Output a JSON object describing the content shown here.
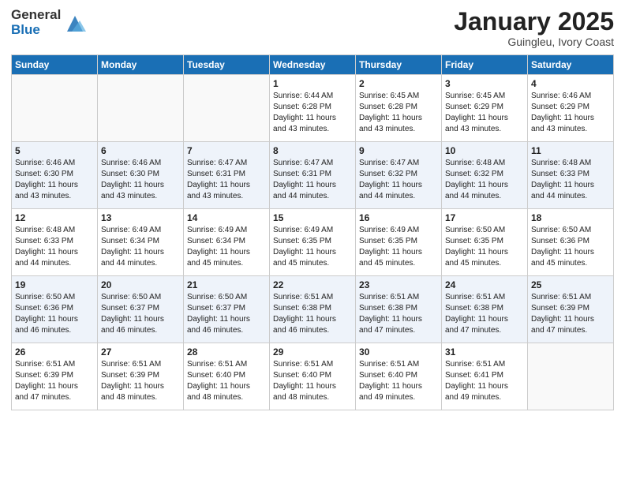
{
  "header": {
    "logo_general": "General",
    "logo_blue": "Blue",
    "month_title": "January 2025",
    "location": "Guingleu, Ivory Coast"
  },
  "weekdays": [
    "Sunday",
    "Monday",
    "Tuesday",
    "Wednesday",
    "Thursday",
    "Friday",
    "Saturday"
  ],
  "weeks": [
    [
      {
        "day": "",
        "info": ""
      },
      {
        "day": "",
        "info": ""
      },
      {
        "day": "",
        "info": ""
      },
      {
        "day": "1",
        "info": "Sunrise: 6:44 AM\nSunset: 6:28 PM\nDaylight: 11 hours\nand 43 minutes."
      },
      {
        "day": "2",
        "info": "Sunrise: 6:45 AM\nSunset: 6:28 PM\nDaylight: 11 hours\nand 43 minutes."
      },
      {
        "day": "3",
        "info": "Sunrise: 6:45 AM\nSunset: 6:29 PM\nDaylight: 11 hours\nand 43 minutes."
      },
      {
        "day": "4",
        "info": "Sunrise: 6:46 AM\nSunset: 6:29 PM\nDaylight: 11 hours\nand 43 minutes."
      }
    ],
    [
      {
        "day": "5",
        "info": "Sunrise: 6:46 AM\nSunset: 6:30 PM\nDaylight: 11 hours\nand 43 minutes."
      },
      {
        "day": "6",
        "info": "Sunrise: 6:46 AM\nSunset: 6:30 PM\nDaylight: 11 hours\nand 43 minutes."
      },
      {
        "day": "7",
        "info": "Sunrise: 6:47 AM\nSunset: 6:31 PM\nDaylight: 11 hours\nand 43 minutes."
      },
      {
        "day": "8",
        "info": "Sunrise: 6:47 AM\nSunset: 6:31 PM\nDaylight: 11 hours\nand 44 minutes."
      },
      {
        "day": "9",
        "info": "Sunrise: 6:47 AM\nSunset: 6:32 PM\nDaylight: 11 hours\nand 44 minutes."
      },
      {
        "day": "10",
        "info": "Sunrise: 6:48 AM\nSunset: 6:32 PM\nDaylight: 11 hours\nand 44 minutes."
      },
      {
        "day": "11",
        "info": "Sunrise: 6:48 AM\nSunset: 6:33 PM\nDaylight: 11 hours\nand 44 minutes."
      }
    ],
    [
      {
        "day": "12",
        "info": "Sunrise: 6:48 AM\nSunset: 6:33 PM\nDaylight: 11 hours\nand 44 minutes."
      },
      {
        "day": "13",
        "info": "Sunrise: 6:49 AM\nSunset: 6:34 PM\nDaylight: 11 hours\nand 44 minutes."
      },
      {
        "day": "14",
        "info": "Sunrise: 6:49 AM\nSunset: 6:34 PM\nDaylight: 11 hours\nand 45 minutes."
      },
      {
        "day": "15",
        "info": "Sunrise: 6:49 AM\nSunset: 6:35 PM\nDaylight: 11 hours\nand 45 minutes."
      },
      {
        "day": "16",
        "info": "Sunrise: 6:49 AM\nSunset: 6:35 PM\nDaylight: 11 hours\nand 45 minutes."
      },
      {
        "day": "17",
        "info": "Sunrise: 6:50 AM\nSunset: 6:35 PM\nDaylight: 11 hours\nand 45 minutes."
      },
      {
        "day": "18",
        "info": "Sunrise: 6:50 AM\nSunset: 6:36 PM\nDaylight: 11 hours\nand 45 minutes."
      }
    ],
    [
      {
        "day": "19",
        "info": "Sunrise: 6:50 AM\nSunset: 6:36 PM\nDaylight: 11 hours\nand 46 minutes."
      },
      {
        "day": "20",
        "info": "Sunrise: 6:50 AM\nSunset: 6:37 PM\nDaylight: 11 hours\nand 46 minutes."
      },
      {
        "day": "21",
        "info": "Sunrise: 6:50 AM\nSunset: 6:37 PM\nDaylight: 11 hours\nand 46 minutes."
      },
      {
        "day": "22",
        "info": "Sunrise: 6:51 AM\nSunset: 6:38 PM\nDaylight: 11 hours\nand 46 minutes."
      },
      {
        "day": "23",
        "info": "Sunrise: 6:51 AM\nSunset: 6:38 PM\nDaylight: 11 hours\nand 47 minutes."
      },
      {
        "day": "24",
        "info": "Sunrise: 6:51 AM\nSunset: 6:38 PM\nDaylight: 11 hours\nand 47 minutes."
      },
      {
        "day": "25",
        "info": "Sunrise: 6:51 AM\nSunset: 6:39 PM\nDaylight: 11 hours\nand 47 minutes."
      }
    ],
    [
      {
        "day": "26",
        "info": "Sunrise: 6:51 AM\nSunset: 6:39 PM\nDaylight: 11 hours\nand 47 minutes."
      },
      {
        "day": "27",
        "info": "Sunrise: 6:51 AM\nSunset: 6:39 PM\nDaylight: 11 hours\nand 48 minutes."
      },
      {
        "day": "28",
        "info": "Sunrise: 6:51 AM\nSunset: 6:40 PM\nDaylight: 11 hours\nand 48 minutes."
      },
      {
        "day": "29",
        "info": "Sunrise: 6:51 AM\nSunset: 6:40 PM\nDaylight: 11 hours\nand 48 minutes."
      },
      {
        "day": "30",
        "info": "Sunrise: 6:51 AM\nSunset: 6:40 PM\nDaylight: 11 hours\nand 49 minutes."
      },
      {
        "day": "31",
        "info": "Sunrise: 6:51 AM\nSunset: 6:41 PM\nDaylight: 11 hours\nand 49 minutes."
      },
      {
        "day": "",
        "info": ""
      }
    ]
  ]
}
